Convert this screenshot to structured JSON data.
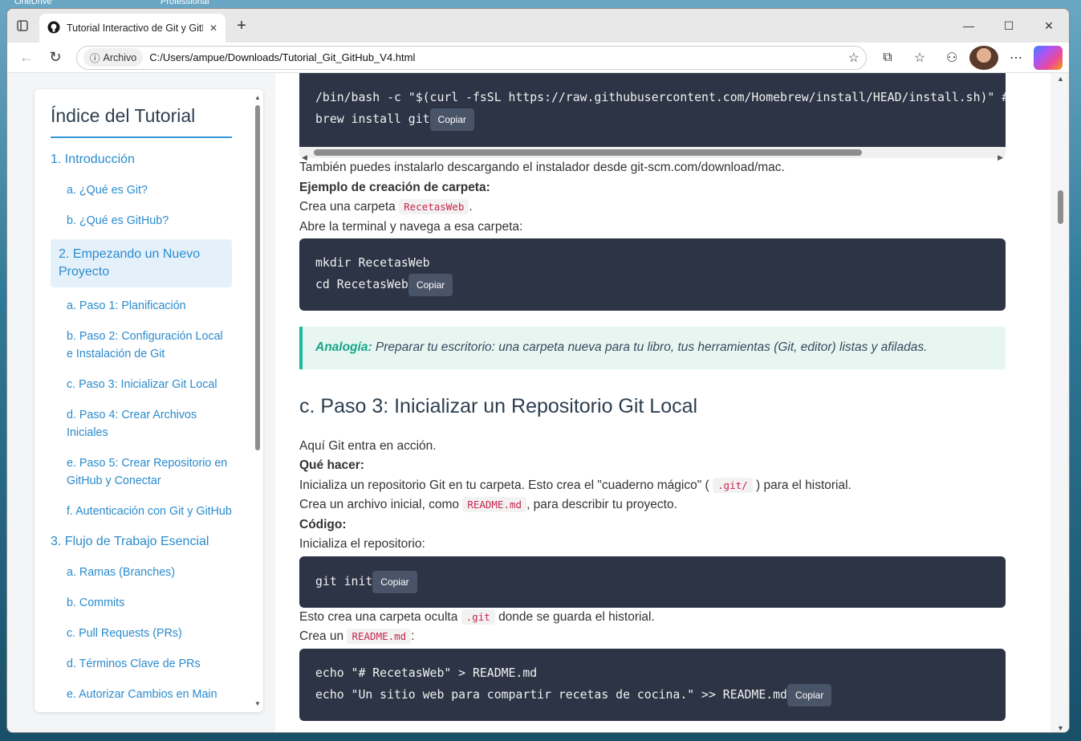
{
  "desktop": {
    "labels": [
      "OneDrive",
      "Professional"
    ]
  },
  "browser": {
    "tab_title": "Tutorial Interactivo de Git y GitHub",
    "new_tab": "+",
    "address_chip": "Archivo",
    "url": "C:/Users/ampue/Downloads/Tutorial_Git_GitHub_V4.html"
  },
  "sidebar": {
    "title": "Índice del Tutorial",
    "items": [
      {
        "label": "1. Introducción",
        "level": "main"
      },
      {
        "label": "a. ¿Qué es Git?",
        "level": "sub"
      },
      {
        "label": "b. ¿Qué es GitHub?",
        "level": "sub"
      },
      {
        "label": "2. Empezando un Nuevo Proyecto",
        "level": "main",
        "active": true
      },
      {
        "label": "a. Paso 1: Planificación",
        "level": "sub"
      },
      {
        "label": "b. Paso 2: Configuración Local e Instalación de Git",
        "level": "sub"
      },
      {
        "label": "c. Paso 3: Inicializar Git Local",
        "level": "sub"
      },
      {
        "label": "d. Paso 4: Crear Archivos Iniciales",
        "level": "sub"
      },
      {
        "label": "e. Paso 5: Crear Repositorio en GitHub y Conectar",
        "level": "sub"
      },
      {
        "label": "f. Autenticación con Git y GitHub",
        "level": "sub"
      },
      {
        "label": "3. Flujo de Trabajo Esencial",
        "level": "main"
      },
      {
        "label": "a. Ramas (Branches)",
        "level": "sub"
      },
      {
        "label": "b. Commits",
        "level": "sub"
      },
      {
        "label": "c. Pull Requests (PRs)",
        "level": "sub"
      },
      {
        "label": "d. Términos Clave de PRs",
        "level": "sub"
      },
      {
        "label": "e. Autorizar Cambios en Main",
        "level": "sub"
      }
    ]
  },
  "content": {
    "copy_label": "Copiar",
    "code1": {
      "line1": "/bin/bash -c \"$(curl -fsSL https://raw.githubusercontent.com/Homebrew/install/HEAD/install.sh)\" #",
      "line2": "brew install git"
    },
    "p_mac": "También puedes instalarlo descargando el instalador desde git-scm.com/download/mac.",
    "ej_title": "Ejemplo de creación de carpeta:",
    "p_crea_pre": "Crea una carpeta",
    "p_crea_code": "RecetasWeb",
    "p_crea_post": ".",
    "p_abre": "Abre la terminal y navega a esa carpeta:",
    "code2": {
      "line1": "mkdir RecetasWeb",
      "line2": "cd RecetasWeb"
    },
    "analogy_label": "Analogía:",
    "analogy_text": " Preparar tu escritorio: una carpeta nueva para tu libro, tus herramientas (Git, editor) listas y afiladas.",
    "h2": "c. Paso 3: Inicializar un Repositorio Git Local",
    "p_aqui": "Aquí Git entra en acción.",
    "que_hacer": "Qué hacer:",
    "p_init_pre": "Inicializa un repositorio Git en tu carpeta. Esto crea el \"cuaderno mágico\" (",
    "p_init_code": ".git/",
    "p_init_post": ") para el historial.",
    "p_readme_pre": "Crea un archivo inicial, como",
    "p_readme_code": "README.md",
    "p_readme_post": ", para describir tu proyecto.",
    "codigo": "Código:",
    "p_inicializa": "Inicializa el repositorio:",
    "code3": {
      "line1": "git init"
    },
    "p_oculta_pre": "Esto crea una carpeta oculta",
    "p_oculta_code": ".git",
    "p_oculta_post": "donde se guarda el historial.",
    "p_creaun_pre": "Crea un",
    "p_creaun_code": "README.md",
    "p_creaun_post": ":",
    "code4": {
      "line1": "echo \"# RecetasWeb\" > README.md",
      "line2": "echo \"Un sitio web para compartir recetas de cocina.\" >> README.md"
    }
  }
}
